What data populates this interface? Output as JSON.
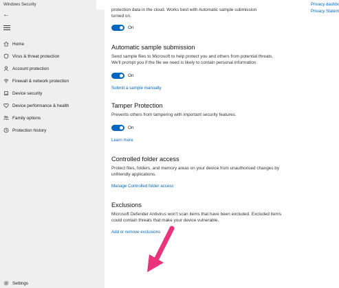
{
  "window": {
    "title": "Windows Security"
  },
  "sidebar": {
    "items": [
      {
        "label": "Home",
        "icon": "home-icon"
      },
      {
        "label": "Virus & threat protection",
        "icon": "shield-icon"
      },
      {
        "label": "Account protection",
        "icon": "person-icon"
      },
      {
        "label": "Firewall & network protection",
        "icon": "wifi-icon"
      },
      {
        "label": "Device security",
        "icon": "laptop-icon"
      },
      {
        "label": "Device performance & health",
        "icon": "heart-icon"
      },
      {
        "label": "Family options",
        "icon": "family-icon"
      },
      {
        "label": "Protection history",
        "icon": "history-icon"
      }
    ],
    "settings_label": "Settings"
  },
  "right_links": {
    "privacy_dashboard": "Privacy dashboard",
    "privacy_statement": "Privacy Statement"
  },
  "sections": {
    "cloud": {
      "desc": "protection data in the cloud. Works best with Automatic sample submission turned on.",
      "toggle": "On"
    },
    "sample": {
      "title": "Automatic sample submission",
      "desc": "Send sample files to Microsoft to help protect you and others from potential threats. We'll prompt you if the file we need is likely to contain personal information.",
      "toggle": "On",
      "link": "Submit a sample manually"
    },
    "tamper": {
      "title": "Tamper Protection",
      "desc": "Prevents others from tampering with important security features.",
      "toggle": "On",
      "link": "Learn more"
    },
    "cfa": {
      "title": "Controlled folder access",
      "desc": "Protect files, folders, and memory areas on your device from unauthorised changes by unfriendly applications.",
      "link": "Manage Controlled folder access"
    },
    "exclusions": {
      "title": "Exclusions",
      "desc": "Microsoft Defender Antivirus won't scan items that have been excluded. Excluded items could contain threats that make your device vulnerable.",
      "link": "Add or remove exclusions"
    }
  },
  "colors": {
    "accent": "#0067c0",
    "sidebar": "#efefef",
    "arrow": "#e8347a"
  }
}
